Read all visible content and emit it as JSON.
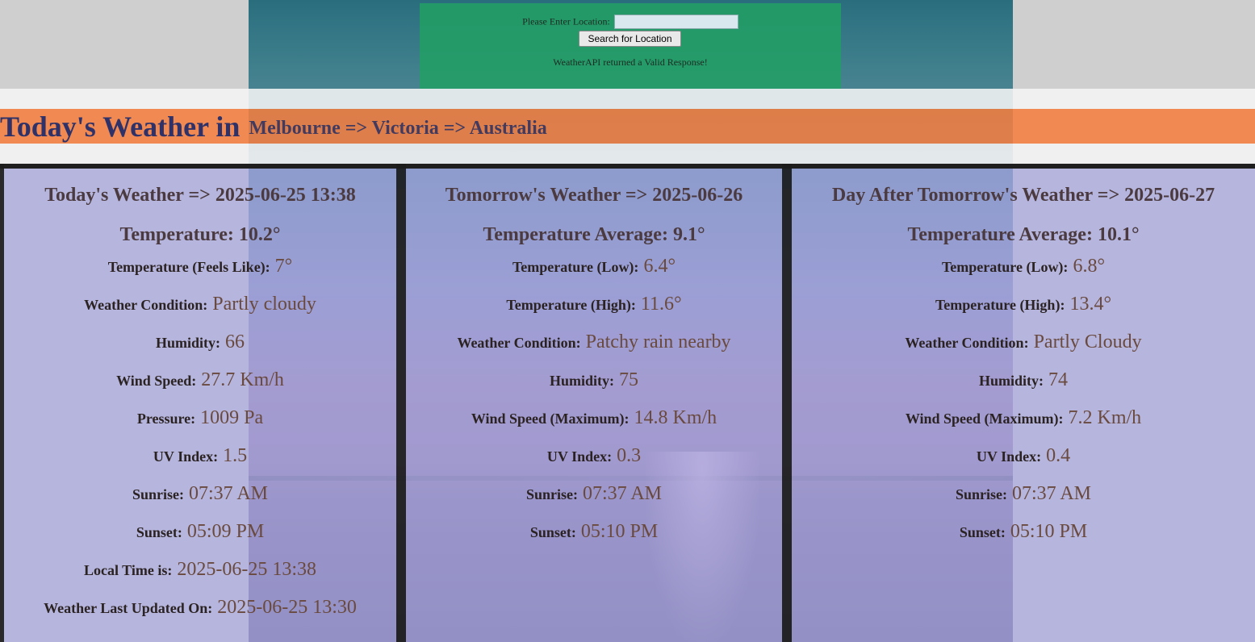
{
  "search": {
    "label": "Please Enter Location:",
    "input_value": "",
    "button_label": "Search for Location",
    "status": "WeatherAPI returned a Valid Response!"
  },
  "header": {
    "title": "Today's Weather in",
    "location": "Melbourne => Victoria => Australia"
  },
  "today": {
    "heading": "Today's Weather => 2025-06-25 13:38",
    "temperature": "Temperature: 10.2°",
    "rows": [
      {
        "label": "Temperature (Feels Like):",
        "value": "7°"
      },
      {
        "label": "Weather Condition:",
        "value": "Partly cloudy"
      },
      {
        "label": "Humidity:",
        "value": "66"
      },
      {
        "label": "Wind Speed:",
        "value": "27.7 Km/h"
      },
      {
        "label": "Pressure:",
        "value": "1009 Pa"
      },
      {
        "label": "UV Index:",
        "value": "1.5"
      },
      {
        "label": "Sunrise:",
        "value": "07:37 AM"
      },
      {
        "label": "Sunset:",
        "value": "05:09 PM"
      },
      {
        "label": "Local Time is:",
        "value": "2025-06-25 13:38"
      },
      {
        "label": "Weather Last Updated On:",
        "value": "2025-06-25 13:30"
      }
    ]
  },
  "tomorrow": {
    "heading": "Tomorrow's Weather => 2025-06-26",
    "temperature": "Temperature Average: 9.1°",
    "rows": [
      {
        "label": "Temperature (Low):",
        "value": "6.4°"
      },
      {
        "label": "Temperature (High):",
        "value": "11.6°"
      },
      {
        "label": "Weather Condition:",
        "value": "Patchy rain nearby"
      },
      {
        "label": "Humidity:",
        "value": "75"
      },
      {
        "label": "Wind Speed (Maximum):",
        "value": "14.8 Km/h"
      },
      {
        "label": "UV Index:",
        "value": "0.3"
      },
      {
        "label": "Sunrise:",
        "value": "07:37 AM"
      },
      {
        "label": "Sunset:",
        "value": "05:10 PM"
      }
    ]
  },
  "day_after": {
    "heading": "Day After Tomorrow's Weather => 2025-06-27",
    "temperature": "Temperature Average: 10.1°",
    "rows": [
      {
        "label": "Temperature (Low):",
        "value": "6.8°"
      },
      {
        "label": "Temperature (High):",
        "value": "13.4°"
      },
      {
        "label": "Weather Condition:",
        "value": "Partly Cloudy"
      },
      {
        "label": "Humidity:",
        "value": "74"
      },
      {
        "label": "Wind Speed (Maximum):",
        "value": "7.2 Km/h"
      },
      {
        "label": "UV Index:",
        "value": "0.4"
      },
      {
        "label": "Sunrise:",
        "value": "07:37 AM"
      },
      {
        "label": "Sunset:",
        "value": "05:10 PM"
      }
    ]
  }
}
